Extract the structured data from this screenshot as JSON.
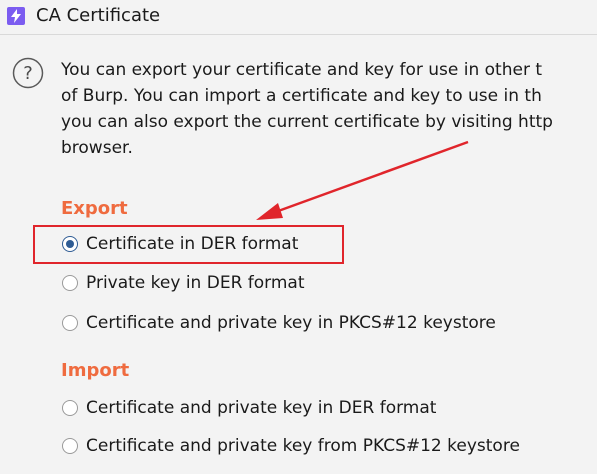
{
  "window": {
    "title": "CA Certificate",
    "icon": "burp-lightning-icon"
  },
  "description": {
    "lines": [
      "You can export your certificate and key for use in other t",
      "of Burp. You can import a certificate and key to use in th",
      "you can also export the current certificate by visiting http",
      "browser."
    ]
  },
  "export": {
    "heading": "Export",
    "options": [
      {
        "label": "Certificate in DER format",
        "selected": true
      },
      {
        "label": "Private key in DER format",
        "selected": false
      },
      {
        "label": "Certificate and private key in PKCS#12 keystore",
        "selected": false
      }
    ]
  },
  "import": {
    "heading": "Import",
    "options": [
      {
        "label": "Certificate and private key in DER format",
        "selected": false
      },
      {
        "label": "Certificate and private key from PKCS#12 keystore",
        "selected": false
      }
    ]
  },
  "colors": {
    "section_heading": "#ef6b3f",
    "annotation": "#e0252b",
    "radio_selected": "#2f5c94",
    "app_icon": "#7b5cf0"
  }
}
